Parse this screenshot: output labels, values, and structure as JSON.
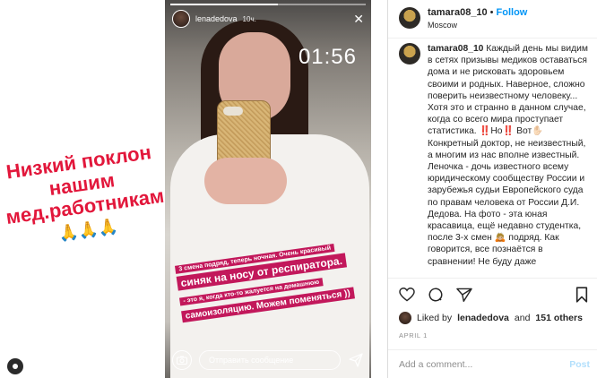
{
  "left_caption": {
    "line1": "Низкий поклон",
    "line2": "нашим",
    "line3": "мед.работникам",
    "emoji": "🙏🙏🙏"
  },
  "story": {
    "username": "lenadedova",
    "time_ago": "10ч.",
    "progress": 0.55,
    "timer": "01:56",
    "sticker": {
      "line1": "3 смена подряд, теперь ночная. Очень красивый",
      "line2": "синяк на носу от респиратора.",
      "line3": "- это я, когда кто-то жалуется на домашнюю",
      "line4": "самоизоляцию. Можем поменяться ))"
    },
    "reply_placeholder": "Отправить сообщение"
  },
  "post": {
    "username": "tamara08_10",
    "separator": "•",
    "follow_label": "Follow",
    "location": "Moscow",
    "caption_user": "tamara08_10",
    "caption": " Каждый день мы видим в сетях призывы медиков оставаться дома и не рисковать здоровьем своими и родных. Наверное, сложно поверить неизвестному человеку... Хотя это и странно в данном случае, когда со всего мира проступает статистика. ‼️Но‼️ Вот✋🏻 Конкретный доктор, не неизвестный, а многим из нас вполне известный. Леночка - дочь известного всему юридическому сообществу России и зарубежья судьи Европейского суда по правам человека от России Д.И. Дедова. На фото - эта юная красавица, ещё недавно студентка, после 3-х смен 🙇🏼 подряд. Как говорится, все познаётся в сравнении! Не буду даже",
    "liked_by_prefix": "Liked by",
    "liked_by_user": "lenadedova",
    "and_label": "and",
    "others_count": "151 others",
    "date": "APRIL 1",
    "comment_placeholder": "Add a comment...",
    "post_label": "Post"
  },
  "colors": {
    "caption_red": "#e2173b",
    "sticker_magenta": "#c2185b",
    "follow_blue": "#0095f6"
  }
}
